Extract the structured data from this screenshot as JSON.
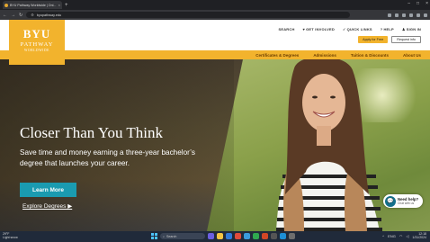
{
  "browser": {
    "tab_title": "BYU Pathway Worldwide | Onl...",
    "url": "byupathway.edu",
    "new_tab_label": "+",
    "tab_close": "×"
  },
  "header": {
    "logo": {
      "line1": "BYU",
      "line2": "PATHWAY",
      "line3": "WORLDWIDE"
    },
    "util_links": [
      "SEARCH",
      "GET INVOLVED",
      "QUICK LINKS",
      "HELP",
      "SIGN IN"
    ],
    "apply_label": "Apply for Free",
    "request_label": "Request info"
  },
  "nav": [
    "Certificates & Degrees",
    "Admissions",
    "Tuition & Discounts",
    "About Us"
  ],
  "hero": {
    "title": "Closer Than You Think",
    "subtitle": "Save time and money earning a three-year bachelor’s degree that launches your career.",
    "learn_more": "Learn More",
    "explore": "Explore Degrees ▶"
  },
  "chat": {
    "title": "Need help?",
    "sub": "Chat with us"
  },
  "taskbar": {
    "weather_temp": "29°F",
    "weather_desc": "Light snow",
    "search_placeholder": "Search",
    "time": "12:18",
    "date": "1/31/2024",
    "lang": "ENG"
  },
  "colors": {
    "gold": "#f2b32d",
    "teal": "#1a9bb0",
    "nav_text": "#6b3d00"
  }
}
